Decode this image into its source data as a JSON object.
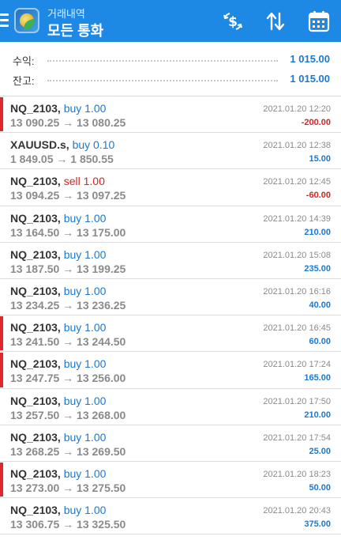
{
  "header": {
    "subtitle": "거래내역",
    "title": "모든 통화",
    "bg_color": "#1e88e5",
    "icons": [
      "menu-icon",
      "app-logo",
      "currency-filter-icon",
      "sort-icon",
      "calendar-icon"
    ]
  },
  "summary": {
    "profit_label": "수익:",
    "profit_value": "1 015.00",
    "balance_label": "잔고:",
    "balance_value": "1 015.00"
  },
  "colors": {
    "buy": "#1c78d0",
    "sell": "#d32626",
    "marker": "#e1262d",
    "muted": "#8a8a8a"
  },
  "trades": [
    {
      "symbol": "NQ_2103,",
      "side": "buy 1.00",
      "side_type": "buy",
      "prices": "13 090.25 → 13 080.25",
      "time": "2021.01.20 12:20",
      "profit": "-200.00",
      "profit_type": "neg",
      "marked": true
    },
    {
      "symbol": "XAUUSD.s,",
      "side": "buy 0.10",
      "side_type": "buy",
      "prices": "1 849.05 → 1 850.55",
      "time": "2021.01.20 12:38",
      "profit": "15.00",
      "profit_type": "pos",
      "marked": false
    },
    {
      "symbol": "NQ_2103,",
      "side": "sell 1.00",
      "side_type": "sell",
      "prices": "13 094.25 → 13 097.25",
      "time": "2021.01.20 12:45",
      "profit": "-60.00",
      "profit_type": "neg",
      "marked": false
    },
    {
      "symbol": "NQ_2103,",
      "side": "buy 1.00",
      "side_type": "buy",
      "prices": "13 164.50 → 13 175.00",
      "time": "2021.01.20 14:39",
      "profit": "210.00",
      "profit_type": "pos",
      "marked": false
    },
    {
      "symbol": "NQ_2103,",
      "side": "buy 1.00",
      "side_type": "buy",
      "prices": "13 187.50 → 13 199.25",
      "time": "2021.01.20 15:08",
      "profit": "235.00",
      "profit_type": "pos",
      "marked": false
    },
    {
      "symbol": "NQ_2103,",
      "side": "buy 1.00",
      "side_type": "buy",
      "prices": "13 234.25 → 13 236.25",
      "time": "2021.01.20 16:16",
      "profit": "40.00",
      "profit_type": "pos",
      "marked": false
    },
    {
      "symbol": "NQ_2103,",
      "side": "buy 1.00",
      "side_type": "buy",
      "prices": "13 241.50 → 13 244.50",
      "time": "2021.01.20 16:45",
      "profit": "60.00",
      "profit_type": "pos",
      "marked": true
    },
    {
      "symbol": "NQ_2103,",
      "side": "buy 1.00",
      "side_type": "buy",
      "prices": "13 247.75 → 13 256.00",
      "time": "2021.01.20 17:24",
      "profit": "165.00",
      "profit_type": "pos",
      "marked": true
    },
    {
      "symbol": "NQ_2103,",
      "side": "buy 1.00",
      "side_type": "buy",
      "prices": "13 257.50 → 13 268.00",
      "time": "2021.01.20 17:50",
      "profit": "210.00",
      "profit_type": "pos",
      "marked": false
    },
    {
      "symbol": "NQ_2103,",
      "side": "buy 1.00",
      "side_type": "buy",
      "prices": "13 268.25 → 13 269.50",
      "time": "2021.01.20 17:54",
      "profit": "25.00",
      "profit_type": "pos",
      "marked": false
    },
    {
      "symbol": "NQ_2103,",
      "side": "buy 1.00",
      "side_type": "buy",
      "prices": "13 273.00 → 13 275.50",
      "time": "2021.01.20 18:23",
      "profit": "50.00",
      "profit_type": "pos",
      "marked": true
    },
    {
      "symbol": "NQ_2103,",
      "side": "buy 1.00",
      "side_type": "buy",
      "prices": "13 306.75 → 13 325.50",
      "time": "2021.01.20 20:43",
      "profit": "375.00",
      "profit_type": "pos",
      "marked": false
    }
  ]
}
